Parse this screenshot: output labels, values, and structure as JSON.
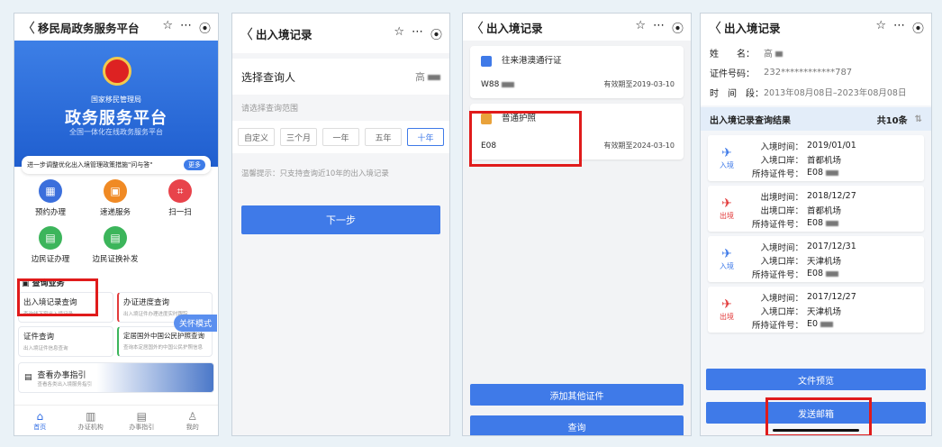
{
  "screen1": {
    "nav_title": "移民局政务服务平台",
    "hero": {
      "bureau": "国家移民管理局",
      "platform": "政务服务平台",
      "slogan": "全国一体化在线政务服务平台"
    },
    "banner": {
      "text": "进一步调整优化出入境管理政策措施\"问与答\"",
      "more": "更多"
    },
    "services": [
      {
        "label": "预约办理",
        "icon": "calendar-icon",
        "color": "#3b6fdc"
      },
      {
        "label": "速递服务",
        "icon": "delivery-icon",
        "color": "#f08a24"
      },
      {
        "label": "扫一扫",
        "icon": "scan-icon",
        "color": "#e8434b"
      },
      {
        "label": "边民证办理",
        "icon": "border-pass-icon",
        "color": "#3cb55b"
      },
      {
        "label": "边民证换补发",
        "icon": "border-pass-renew-icon",
        "color": "#3cb55b"
      }
    ],
    "section_title": "查询业务",
    "query_cards": [
      {
        "title": "出入境记录查询",
        "sub": "查询线下窗出入境记录"
      },
      {
        "title": "办证进度查询",
        "sub": "出入境证件办理进度实时跟踪"
      },
      {
        "title": "证件查询",
        "sub": "出入境证件信息查询"
      },
      {
        "title": "定居国外中国公民护照查询",
        "sub": "查询本定居国外的中国公民护照信息"
      }
    ],
    "guide": {
      "title": "查看办事指引",
      "sub": "查看各类出入境服务指引"
    },
    "care_mode": "关怀模式",
    "tabs": [
      "首页",
      "办证机构",
      "办事指引",
      "我的"
    ]
  },
  "screen2": {
    "nav_title": "出入境记录",
    "select_label": "选择查询人",
    "select_value": "高",
    "range_hint": "请选择查询范围",
    "ranges": [
      "自定义",
      "三个月",
      "一年",
      "五年",
      "十年"
    ],
    "selected_range": "十年",
    "tip": "温馨提示：只支持查询近10年的出入境记录",
    "next_button": "下一步"
  },
  "screen3": {
    "nav_title": "出入境记录",
    "certs": [
      {
        "name": "往来港澳通行证",
        "no": "W88",
        "expiry": "有效期至2019-03-10",
        "color": "#3f7ae8"
      },
      {
        "name": "普通护照",
        "no": "E08",
        "expiry": "有效期至2024-03-10",
        "color": "#e9a23b"
      }
    ],
    "add_button": "添加其他证件",
    "query_button": "查询"
  },
  "screen4": {
    "nav_title": "出入境记录",
    "name_label": "姓　　名：",
    "name_value": "高",
    "id_label": "证件号码：",
    "id_value": "232************787",
    "period_label": "时　间　段：",
    "period_value": "2013年08月08日–2023年08月08日",
    "result_title": "出入境记录查询结果",
    "result_count": "共10条",
    "records": [
      {
        "type": "入境",
        "time_label": "入境时间：",
        "time": "2019/01/01",
        "port_label": "入境口岸：",
        "port": "首都机场",
        "cert_label": "所持证件号：",
        "cert": "E08",
        "color": "#3f7ae8"
      },
      {
        "type": "出境",
        "time_label": "出境时间：",
        "time": "2018/12/27",
        "port_label": "出境口岸：",
        "port": "首都机场",
        "cert_label": "所持证件号：",
        "cert": "E08",
        "color": "#e23b3b"
      },
      {
        "type": "入境",
        "time_label": "入境时间：",
        "time": "2017/12/31",
        "port_label": "入境口岸：",
        "port": "天津机场",
        "cert_label": "所持证件号：",
        "cert": "E08",
        "color": "#3f7ae8"
      },
      {
        "type": "出境",
        "time_label": "入境时间：",
        "time": "2017/12/27",
        "port_label": "入境口岸：",
        "port": "天津机场",
        "cert_label": "所持证件号：",
        "cert": "E0",
        "color": "#e23b3b"
      }
    ],
    "preview_button": "文件预览",
    "email_button": "发送邮箱"
  }
}
